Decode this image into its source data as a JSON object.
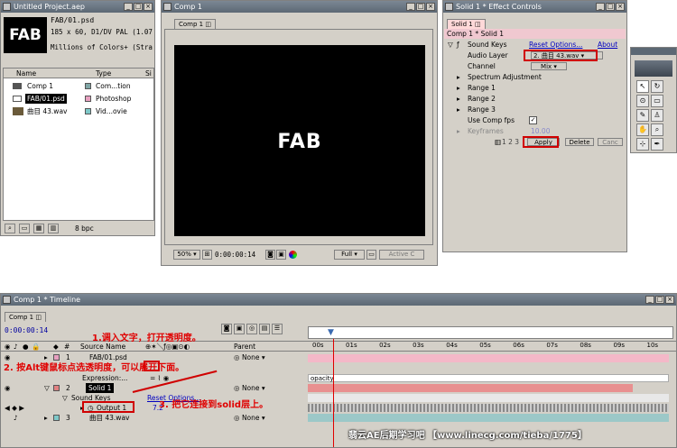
{
  "project": {
    "title": "Untitled Project.aep",
    "thumb_text": "FAB",
    "file_name": "FAB/01.psd",
    "info_line1": "185 x 60, D1/DV PAL (1.07",
    "info_line2": "Millions of Colors+ (Stra",
    "col_name": "Name",
    "col_type": "Type",
    "col_size": "Si",
    "items": [
      {
        "name": "Comp 1",
        "type": "Com...tion",
        "color": "#7fa6a6",
        "icon": "comp-icon"
      },
      {
        "name": "FAB/01.psd",
        "type": "Photoshop",
        "color": "#e8a0c0",
        "icon": "psd-icon"
      },
      {
        "name": "曲目 43.wav",
        "type": "Vid...ovie",
        "color": "#7ec8c8",
        "icon": "audio-icon"
      }
    ],
    "bpc": "8 bpc"
  },
  "comp": {
    "title": "Comp 1",
    "tab": "Comp 1",
    "canvas_text": "FAB",
    "zoom": "50%",
    "timecode": "0:00:00:14",
    "res": "Full",
    "camera": "Active C"
  },
  "effect": {
    "title": "Solid 1 * Effect Controls",
    "tab": "Solid 1",
    "breadcrumb": "Comp 1 * Solid 1",
    "fx_name": "Sound Keys",
    "reset": "Reset Options...",
    "about": "About",
    "audio_layer_label": "Audio Layer",
    "audio_layer_value": "2. 曲目 43.wav",
    "channel_label": "Channel",
    "channel_value": "Mix",
    "spectrum": "Spectrum Adjustment",
    "range1": "Range 1",
    "range2": "Range 2",
    "range3": "Range 3",
    "use_comp_fps": "Use Comp fps",
    "keyframes_label": "Keyframes",
    "keyframes_value": "10.00",
    "range_nums": "1 2 3",
    "apply": "Apply",
    "delete": "Delete",
    "cancel": "Canc"
  },
  "timeline": {
    "title": "Comp 1 * Timeline",
    "tab": "Comp 1",
    "timecode": "0:00:00:14",
    "col_num": "#",
    "col_source": "Source Name",
    "col_parent": "Parent",
    "ticks": [
      "00s",
      "01s",
      "02s",
      "03s",
      "04s",
      "05s",
      "06s",
      "07s",
      "08s",
      "09s",
      "10s"
    ],
    "layers": [
      {
        "num": "1",
        "name": "FAB/01.psd",
        "parent": "None"
      },
      {
        "num": "2",
        "name": "Solid 1",
        "parent": "None"
      },
      {
        "num": "3",
        "name": "曲目 43.wav",
        "parent": "None"
      }
    ],
    "expression": "Expression:...",
    "opacity_text": "opacity",
    "sound_keys": "Sound Keys",
    "reset_options": "Reset Options...",
    "output": "Output 1",
    "output_val": "7.2"
  },
  "annotations": {
    "a1": "1.调入文字，打开透明度。",
    "a2": "2. 按Alt键鼠标点选透明度，可以展开下面。",
    "a3": "3. 把它连接到solid层上。"
  },
  "watermark": "翡云AE后期学习吧 【www.linecg.com/tieba/1775】",
  "colors": {
    "accent": "#d00000",
    "pink": "#f4b8c8",
    "teal": "#9cc8c8",
    "title_blue": "#0a246a"
  }
}
